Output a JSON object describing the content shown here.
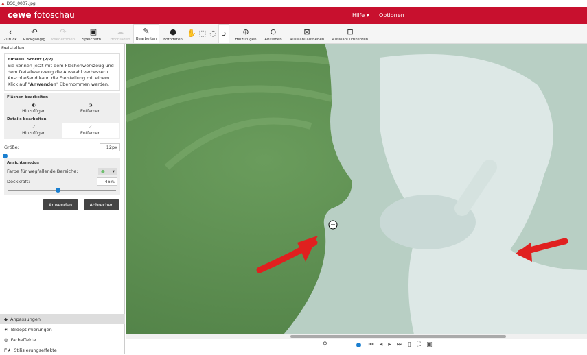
{
  "window": {
    "title": "DSC_0007.jpg"
  },
  "app": {
    "logo_brand": "cewe",
    "logo_product": "fotoschau",
    "menu": [
      "Hilfe",
      "Optionen"
    ]
  },
  "toolbar": {
    "back": "Zurück",
    "undo": "Rückgängig",
    "redo": "Wiederholen",
    "save": "Speichern...",
    "upload": "Hochladen",
    "edit": "Bearbeiten",
    "photo_data": "Fotodaten",
    "add": "Hinzufügen",
    "subtract": "Abziehen",
    "deselect": "Auswahl aufheben",
    "invert": "Auswahl umkehren"
  },
  "panel": {
    "title": "Freistellen",
    "hint_title": "Hinweis: Schritt (2/2)",
    "hint_text1": "Sie können jetzt mit dem Flächenwerkzeug und dem Detailwerkzeug die Auswahl verbessern. Anschließend kann die Freistellung mit einem Klick auf \"",
    "hint_bold": "Anwenden",
    "hint_text2": "\" übernommen werden.",
    "areas_title": "Flächen bearbeiten",
    "areas_add": "Hinzufügen",
    "areas_remove": "Entfernen",
    "details_title": "Details bearbeiten",
    "details_add": "Hinzufügen",
    "details_remove": "Entfernen",
    "size_label": "Größe:",
    "size_value": "12px",
    "size_slider": 0.02,
    "view_title": "Ansichtsmodus",
    "color_label": "Farbe für wegfallende Bereiche:",
    "color_value": "#6fbf6f",
    "opacity_label": "Deckkraft:",
    "opacity_value": "46%",
    "opacity_slider": 0.46,
    "apply": "Anwenden",
    "cancel": "Abbrechen"
  },
  "nav": [
    "Anpassungen",
    "Bildoptimierungen",
    "Farbeffekte",
    "Stilisierungseffekte"
  ],
  "zoom_slider": 0.85
}
